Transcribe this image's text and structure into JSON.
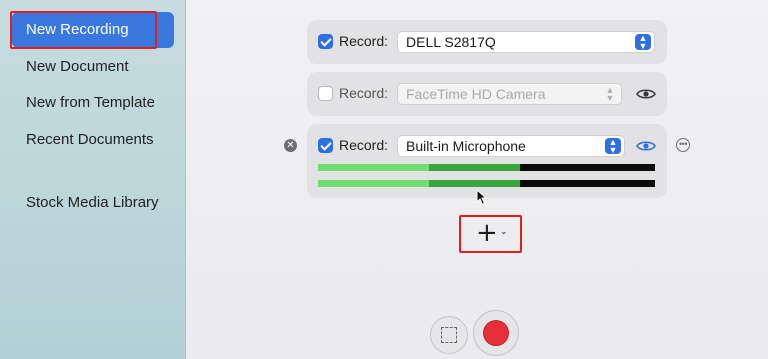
{
  "sidebar": {
    "items": [
      {
        "label": "New Recording",
        "selected": true
      },
      {
        "label": "New Document",
        "selected": false
      },
      {
        "label": "New from Template",
        "selected": false
      },
      {
        "label": "Recent Documents",
        "selected": false
      },
      {
        "label": "Stock Media Library",
        "selected": false
      }
    ]
  },
  "sources": [
    {
      "label": "Record:",
      "checked": true,
      "device": "DELL S2817Q",
      "enabled": true,
      "has_preview": false
    },
    {
      "label": "Record:",
      "checked": false,
      "device": "FaceTime HD Camera",
      "enabled": false,
      "has_preview": true
    },
    {
      "label": "Record:",
      "checked": true,
      "device": "Built-in Microphone",
      "enabled": true,
      "has_preview": true
    }
  ],
  "audio_levels": {
    "left": {
      "green": 0.33,
      "mid_green": 0.6
    },
    "right": {
      "green": 0.33,
      "mid_green": 0.6
    }
  },
  "icons": {
    "add": "plus-icon",
    "add_menu": "chevron-down-icon",
    "remove": "remove-icon",
    "more": "more-options-icon",
    "preview": "eye-icon",
    "select_area": "select-area-icon",
    "record": "record-icon"
  },
  "colors": {
    "accent": "#2f6fe0",
    "selected_item": "#3a78e0",
    "highlight_box": "#e02020",
    "meter_green": "#6fde6f",
    "meter_mid_green": "#39a83a",
    "record_red": "#e5303a"
  }
}
